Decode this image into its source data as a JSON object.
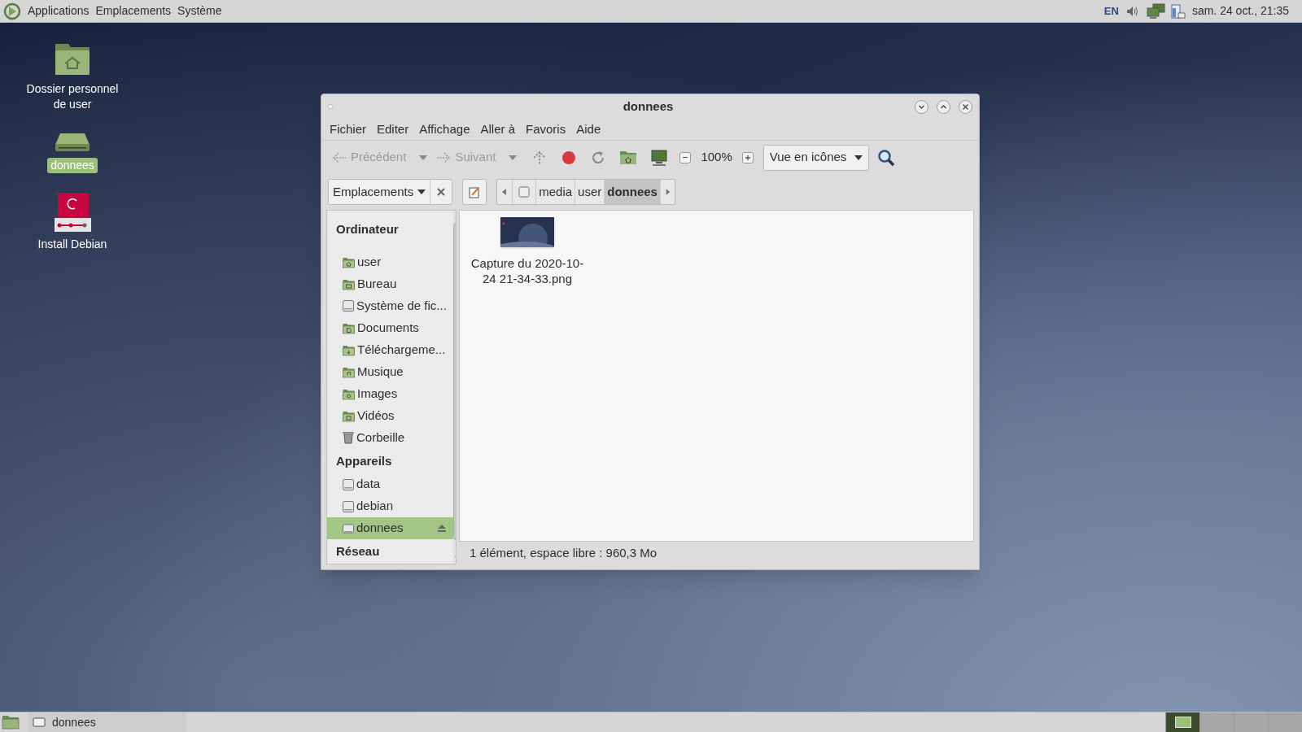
{
  "top_panel": {
    "menus": [
      "Applications",
      "Emplacements",
      "Système"
    ],
    "keyboard_layout": "EN",
    "clock": "sam. 24 oct., 21:35"
  },
  "desktop_icons": [
    {
      "kind": "home",
      "label": "Dossier personnel de user",
      "selected": false
    },
    {
      "kind": "drive",
      "label": "donnees",
      "selected": true
    },
    {
      "kind": "installer",
      "label": "Install Debian",
      "selected": false
    }
  ],
  "window": {
    "title": "donnees",
    "menu": [
      "Fichier",
      "Editer",
      "Affichage",
      "Aller à",
      "Favoris",
      "Aide"
    ],
    "toolbar": {
      "back": {
        "label": "Précédent",
        "disabled": true
      },
      "forward": {
        "label": "Suivant",
        "disabled": true
      },
      "zoom": "100%",
      "view": "Vue en icônes"
    },
    "location_selector": "Emplacements",
    "path": [
      {
        "label": "media",
        "selected": false
      },
      {
        "label": "user",
        "selected": false
      },
      {
        "label": "donnees",
        "selected": true
      }
    ],
    "sidebar": [
      {
        "heading": "Ordinateur",
        "items": [
          {
            "kind": "home",
            "label": "user",
            "selected": false
          },
          {
            "kind": "desktop",
            "label": "Bureau",
            "selected": false
          },
          {
            "kind": "disk",
            "label": "Système de fic...",
            "selected": false
          },
          {
            "kind": "documents",
            "label": "Documents",
            "selected": false
          },
          {
            "kind": "download",
            "label": "Téléchargeme...",
            "selected": false
          },
          {
            "kind": "music",
            "label": "Musique",
            "selected": false
          },
          {
            "kind": "pictures",
            "label": "Images",
            "selected": false
          },
          {
            "kind": "videos",
            "label": "Vidéos",
            "selected": false
          },
          {
            "kind": "trash",
            "label": "Corbeille",
            "selected": false
          }
        ]
      },
      {
        "heading": "Appareils",
        "items": [
          {
            "kind": "disk",
            "label": "data",
            "selected": false
          },
          {
            "kind": "disk",
            "label": "debian",
            "selected": false
          },
          {
            "kind": "volume",
            "label": "donnees",
            "selected": true
          }
        ]
      },
      {
        "heading": "Réseau"
      }
    ],
    "files": [
      {
        "kind": "picture",
        "name": "Capture du 2020-10-24 21-34-33.png"
      }
    ],
    "status": "1 élément, espace libre : 960,3 Mo"
  },
  "taskbar": {
    "tasks": [
      {
        "label": "donnees",
        "selected": false
      }
    ],
    "workspaces": [
      {
        "selected": true
      },
      {
        "selected": false
      },
      {
        "selected": false
      },
      {
        "selected": false
      }
    ]
  }
}
